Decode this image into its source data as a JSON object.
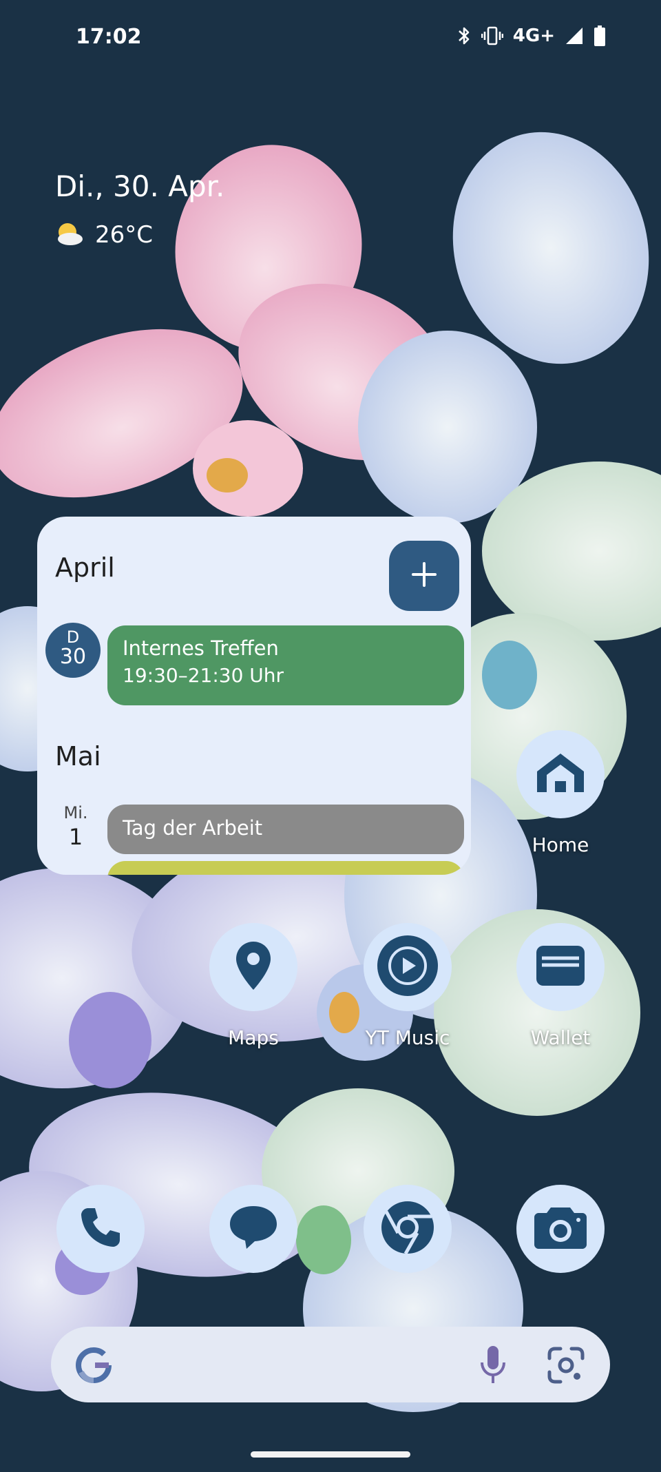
{
  "status_bar": {
    "time": "17:02",
    "network": "4G+",
    "icons": [
      "bluetooth-icon",
      "vibrate-icon",
      "signal-icon",
      "battery-icon"
    ]
  },
  "glance": {
    "date": "Di., 30. Apr.",
    "weather_icon": "partly-sunny-icon",
    "temperature": "26°C"
  },
  "calendar_widget": {
    "sections": [
      {
        "month": "April",
        "days": [
          {
            "dow": "D",
            "day": "30",
            "today": true,
            "events": [
              {
                "title": "Internes Treffen",
                "time": "19:30–21:30 Uhr",
                "color": "#4f9763"
              }
            ]
          }
        ]
      },
      {
        "month": "Mai",
        "days": [
          {
            "dow": "Mi.",
            "day": "1",
            "today": false,
            "events": [
              {
                "title": "Tag der Arbeit",
                "color": "#8a8a8a"
              },
              {
                "title": "",
                "color": "#c7cc54"
              }
            ]
          }
        ]
      }
    ],
    "add_button_icon": "plus-icon"
  },
  "apps": {
    "home": {
      "label": "Home",
      "icon": "home-icon"
    },
    "maps": {
      "label": "Maps",
      "icon": "map-pin-icon"
    },
    "yt_music": {
      "label": "YT Music",
      "icon": "play-circle-icon"
    },
    "wallet": {
      "label": "Wallet",
      "icon": "wallet-icon"
    }
  },
  "dock": [
    {
      "name": "Phone",
      "icon": "phone-icon"
    },
    {
      "name": "Messages",
      "icon": "message-bubble-icon"
    },
    {
      "name": "Chrome",
      "icon": "chrome-icon"
    },
    {
      "name": "Camera",
      "icon": "camera-icon"
    }
  ],
  "search_bar": {
    "icons": [
      "google-g-icon",
      "microphone-icon",
      "lens-icon"
    ]
  },
  "colors": {
    "background": "#1a3145",
    "accent": "#2f5a82",
    "icon_circle": "#d6e6fb",
    "widget_bg": "#e7eefb"
  }
}
